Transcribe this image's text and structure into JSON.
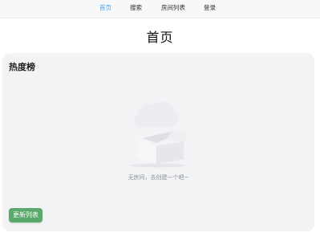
{
  "nav": {
    "items": [
      {
        "label": "首页",
        "active": true
      },
      {
        "label": "搜索",
        "active": false
      },
      {
        "label": "房间列表",
        "active": false
      },
      {
        "label": "登录",
        "active": false
      }
    ],
    "active_color": "#409eff"
  },
  "page": {
    "title": "首页"
  },
  "card": {
    "title": "热度榜",
    "empty_icon": "empty-box-illustration",
    "empty_text": "无房间，去创建一个吧~",
    "refresh_label": "更新列表",
    "refresh_color": "#5aa86b"
  }
}
